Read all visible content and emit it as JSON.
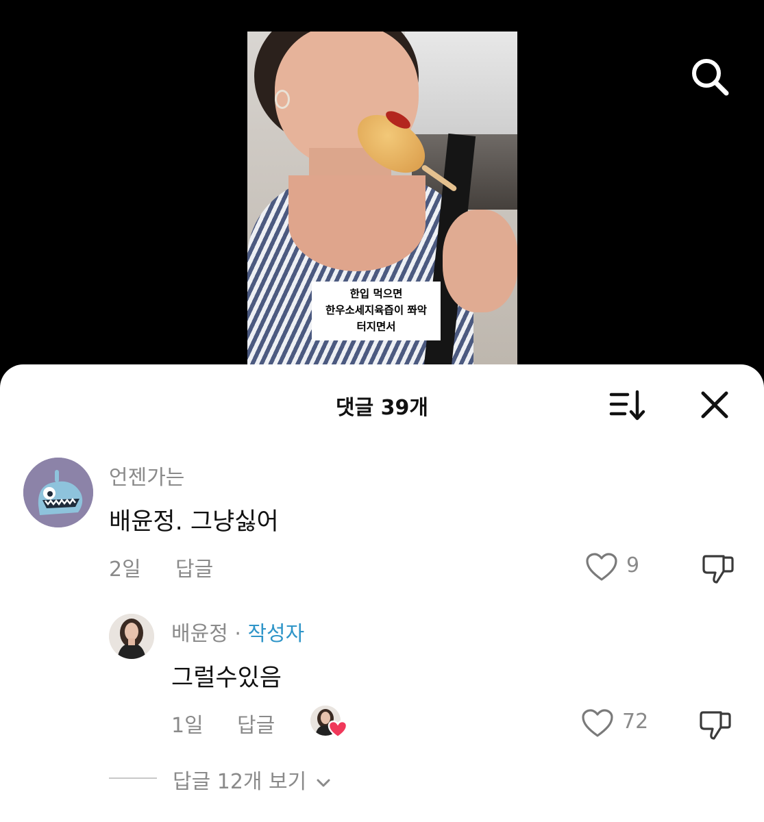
{
  "video": {
    "caption_lines": [
      "한입 먹으면",
      "한우소세지육즙이 쫘악",
      "터지면서"
    ]
  },
  "header": {
    "search_icon": "search-icon"
  },
  "sheet": {
    "title": "댓글 39개",
    "sort_icon": "sort-icon",
    "close_icon": "close-icon"
  },
  "comment": {
    "username": "언젠가는",
    "text": "배윤정. 그냥싫어",
    "age": "2일",
    "reply_label": "답글",
    "like_count": "9"
  },
  "reply": {
    "username": "배윤정",
    "separator": "·",
    "badge": "작성자",
    "text": "그럴수있음",
    "age": "1일",
    "reply_label": "답글",
    "like_count": "72"
  },
  "more_replies": "답글 12개 보기",
  "colors": {
    "author_badge": "#2f95c8",
    "muted_text": "#8a8a8a",
    "heart_badge": "#f0385a"
  }
}
